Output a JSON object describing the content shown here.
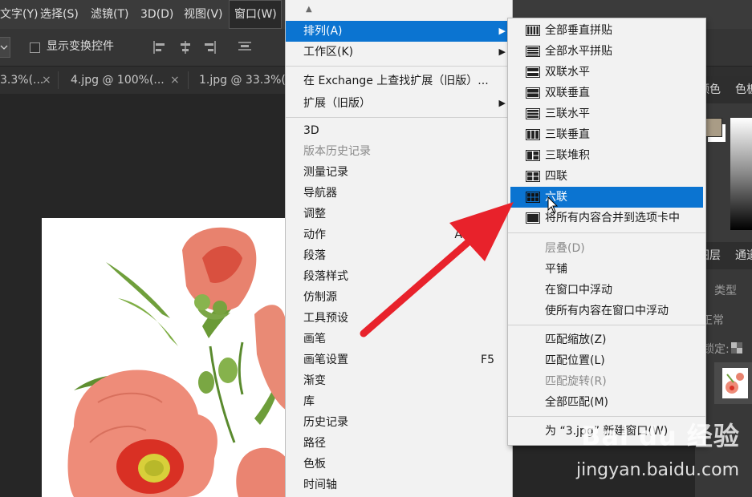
{
  "menubar": {
    "items": [
      "文字(Y)",
      "选择(S)",
      "滤镜(T)",
      "3D(D)",
      "视图(V)",
      "窗口(W)"
    ]
  },
  "options_bar": {
    "show_transform_controls": "显示变换控件"
  },
  "tabs": [
    {
      "title": "3.3%(..."
    },
    {
      "title": "4.jpg @ 100%(..."
    },
    {
      "title": "1.jpg @ 33.3%(..."
    }
  ],
  "tab_close_glyph": "×",
  "right_panel": {
    "color_tab": "颜色",
    "color_tab2": "色板",
    "layers_tab": "图层",
    "channels_tab": "通道",
    "kind_label": "类型",
    "blend_mode": "正常",
    "lock_label": "锁定:"
  },
  "window_menu": {
    "items": [
      {
        "label": "排列(A)",
        "submenu": true,
        "active": true
      },
      {
        "label": "工作区(K)",
        "submenu": true
      },
      {
        "label": "在 Exchange 上查找扩展（旧版）..."
      },
      {
        "label": "扩展（旧版）",
        "submenu": true
      },
      {
        "label": "3D"
      },
      {
        "label": "版本历史记录",
        "disabled": true
      },
      {
        "label": "测量记录"
      },
      {
        "label": "导航器"
      },
      {
        "label": "调整"
      },
      {
        "label": "动作",
        "shortcut": "A"
      },
      {
        "label": "段落"
      },
      {
        "label": "段落样式"
      },
      {
        "label": "仿制源"
      },
      {
        "label": "工具预设"
      },
      {
        "label": "画笔"
      },
      {
        "label": "画笔设置",
        "shortcut": "F5"
      },
      {
        "label": "渐变"
      },
      {
        "label": "库"
      },
      {
        "label": "历史记录"
      },
      {
        "label": "路径"
      },
      {
        "label": "色板"
      },
      {
        "label": "时间轴"
      }
    ]
  },
  "arrange_submenu": {
    "items": [
      {
        "label": "全部垂直拼贴",
        "icon": "tile-vertical-icon"
      },
      {
        "label": "全部水平拼贴",
        "icon": "tile-horizontal-icon"
      },
      {
        "label": "双联水平",
        "icon": "two-up-horizontal-icon"
      },
      {
        "label": "双联垂直",
        "icon": "two-up-vertical-icon"
      },
      {
        "label": "三联水平",
        "icon": "three-up-horizontal-icon"
      },
      {
        "label": "三联垂直",
        "icon": "three-up-vertical-icon"
      },
      {
        "label": "三联堆积",
        "icon": "three-up-stacked-icon"
      },
      {
        "label": "四联",
        "icon": "four-up-icon"
      },
      {
        "label": "六联",
        "icon": "six-up-icon",
        "active": true
      },
      {
        "label": "将所有内容合并到选项卡中",
        "icon": "consolidate-tabs-icon"
      },
      {
        "label": "层叠(D)",
        "disabled": true
      },
      {
        "label": "平铺"
      },
      {
        "label": "在窗口中浮动"
      },
      {
        "label": "使所有内容在窗口中浮动"
      },
      {
        "label": "匹配缩放(Z)"
      },
      {
        "label": "匹配位置(L)"
      },
      {
        "label": "匹配旋转(R)",
        "disabled": true
      },
      {
        "label": "全部匹配(M)"
      },
      {
        "label": "为 “3.jpg” 新建窗口(W)"
      }
    ]
  },
  "colors": {
    "accent": "#0b74d1",
    "annotation_arrow": "#e8222b",
    "menu_bg": "#f2f2f2",
    "app_bg": "#282828"
  },
  "watermark": {
    "line1": "Bai du 经验",
    "line2": "jingyan.baidu.com"
  }
}
